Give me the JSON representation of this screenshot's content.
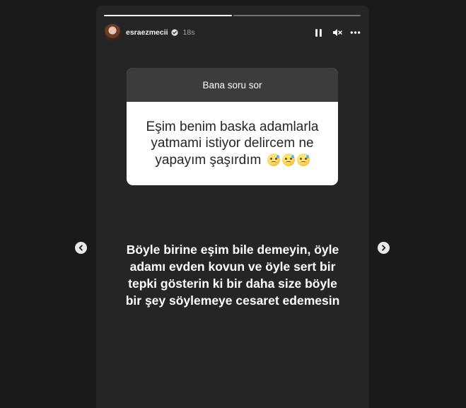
{
  "story": {
    "progress": [
      1.0,
      0.0
    ],
    "user": {
      "username": "esraezmecii",
      "time": "18s",
      "verified": true
    },
    "controls": {
      "pause_icon": "pause-icon",
      "mute_icon": "mute-icon",
      "more_icon": "more-icon"
    },
    "question": {
      "header": "Bana soru sor",
      "text_line1": "Eşim benim baska adamlarla",
      "text_line2": "yatmami istiyor delircem ne",
      "text_line3": "yapayım şaşırdım",
      "emoji_name": "crying-face-icon",
      "emoji_count": 3
    },
    "answer": {
      "line1": "Böyle birine eşim bile demeyin, öyle",
      "line2": "adamı evden kovun ve öyle sert bir",
      "line3": "tepki gösterin ki bir daha size böyle",
      "line4": "bir şey söylemeye cesaret edemesin"
    }
  },
  "navigation": {
    "prev_icon": "chevron-left-icon",
    "next_icon": "chevron-right-icon"
  },
  "colors": {
    "page_bg": "#1a1a1a",
    "story_bg": "#252525",
    "card_header_bg": "#3c3c3c",
    "card_body_bg": "#ffffff",
    "verified_blue": "#3897f0"
  }
}
